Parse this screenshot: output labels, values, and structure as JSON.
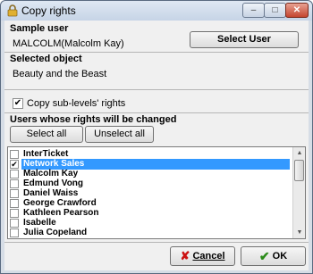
{
  "window": {
    "title": "Copy rights",
    "minimize_glyph": "–",
    "maximize_glyph": "□",
    "close_glyph": "✕"
  },
  "sample_user": {
    "heading": "Sample user",
    "value": "MALCOLM(Malcolm Kay)",
    "button_label": "Select User"
  },
  "selected_object": {
    "heading": "Selected object",
    "value": "Beauty and the Beast"
  },
  "copy_sublevels": {
    "label": "Copy sub-levels' rights",
    "checked": true
  },
  "users": {
    "heading": "Users whose rights will be changed",
    "select_all_label": "Select all",
    "unselect_all_label": "Unselect all",
    "items": [
      {
        "label": "InterTicket",
        "checked": false,
        "selected": false
      },
      {
        "label": "Network Sales",
        "checked": true,
        "selected": true
      },
      {
        "label": "Malcolm Kay",
        "checked": false,
        "selected": false
      },
      {
        "label": "Edmund Vong",
        "checked": false,
        "selected": false
      },
      {
        "label": "Daniel Waiss",
        "checked": false,
        "selected": false
      },
      {
        "label": "George Crawford",
        "checked": false,
        "selected": false
      },
      {
        "label": "Kathleen Pearson",
        "checked": false,
        "selected": false
      },
      {
        "label": "Isabelle",
        "checked": false,
        "selected": false
      },
      {
        "label": "Julia Copeland",
        "checked": false,
        "selected": false
      }
    ]
  },
  "footer": {
    "cancel_label": "Cancel",
    "ok_label": "OK"
  },
  "colors": {
    "selection": "#3399ff",
    "cancel_icon": "#cc1111",
    "ok_icon": "#2a8a18"
  },
  "icons": {
    "app": "lock-icon",
    "cancel": "x-mark-icon",
    "ok": "check-mark-icon"
  }
}
